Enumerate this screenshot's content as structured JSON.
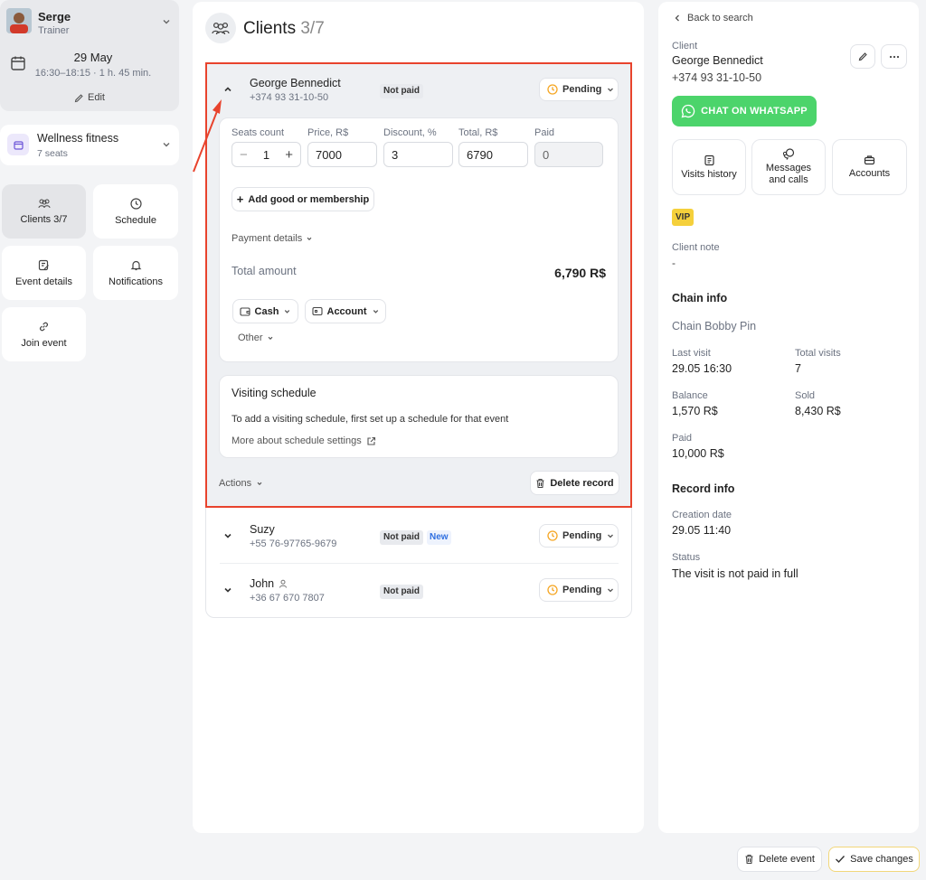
{
  "sidebar": {
    "user": {
      "name": "Serge",
      "role": "Trainer"
    },
    "event": {
      "date": "29 May",
      "time": "16:30–18:15 · 1 h. 45 min.",
      "edit_label": "Edit"
    },
    "room": {
      "name": "Wellness fitness",
      "seats": "7 seats"
    },
    "tiles": [
      {
        "label": "Clients 3/7",
        "icon": "clients-icon"
      },
      {
        "label": "Schedule",
        "icon": "clock-icon"
      },
      {
        "label": "Event details",
        "icon": "edit-icon"
      },
      {
        "label": "Notifications",
        "icon": "bell-icon"
      },
      {
        "label": "Join event",
        "icon": "link-icon"
      }
    ]
  },
  "main": {
    "title": "Clients",
    "count": "3/7",
    "expanded": {
      "name": "George Bennedict",
      "phone": "+374 93 31-10-50",
      "badge": "Not paid",
      "status": "Pending",
      "labels": {
        "seats": "Seats count",
        "price": "Price, R$",
        "discount": "Discount, %",
        "total": "Total, R$",
        "paid": "Paid"
      },
      "values": {
        "seats": "1",
        "price": "7000",
        "discount": "3",
        "total": "6790",
        "paid": "0"
      },
      "add_label": "Add good or membership",
      "payment_details": "Payment details",
      "total_amount_label": "Total amount",
      "total_amount": "6,790 R$",
      "pay_methods": [
        "Cash",
        "Account"
      ],
      "other_label": "Other",
      "visiting": {
        "title": "Visiting schedule",
        "text": "To add a visiting schedule, first set up a schedule for that event",
        "link": "More about schedule settings"
      },
      "actions_label": "Actions",
      "delete_label": "Delete record"
    },
    "rows": [
      {
        "name": "Suzy",
        "phone": "+55 76-97765-9679",
        "badge": "Not paid",
        "new_badge": "New",
        "status": "Pending"
      },
      {
        "name": "John",
        "phone": "+36 67 670 7807",
        "badge": "Not paid",
        "status": "Pending"
      }
    ]
  },
  "right": {
    "back_label": "Back to search",
    "client_label": "Client",
    "client_name": "George Bennedict",
    "client_phone": "+374 93 31-10-50",
    "whatsapp_label": "CHAT ON WHATSAPP",
    "tiles": [
      {
        "label": "Visits history",
        "icon": "history-icon"
      },
      {
        "label": "Messages and calls",
        "icon": "messages-icon"
      },
      {
        "label": "Accounts",
        "icon": "briefcase-icon"
      }
    ],
    "vip_label": "VIP",
    "note_label": "Client note",
    "note_value": "-",
    "chain_title": "Chain info",
    "chain_name": "Chain Bobby Pin",
    "stats": [
      {
        "label": "Last visit",
        "value": "29.05 16:30"
      },
      {
        "label": "Total visits",
        "value": "7"
      },
      {
        "label": "Balance",
        "value": "1,570 R$"
      },
      {
        "label": "Sold",
        "value": "8,430 R$"
      },
      {
        "label": "Paid",
        "value": "10,000 R$"
      }
    ],
    "record_title": "Record info",
    "creation_label": "Creation date",
    "creation_value": "29.05 11:40",
    "status_label": "Status",
    "status_value": "The visit is not paid in full"
  },
  "footer": {
    "delete_event": "Delete event",
    "save_changes": "Save changes"
  },
  "colors": {
    "accent_whatsapp": "#4cd46b",
    "highlight": "#e8432d",
    "vip": "#f5d03b",
    "pending_clock": "#f5a623",
    "new_badge": "#2f6fe0"
  }
}
